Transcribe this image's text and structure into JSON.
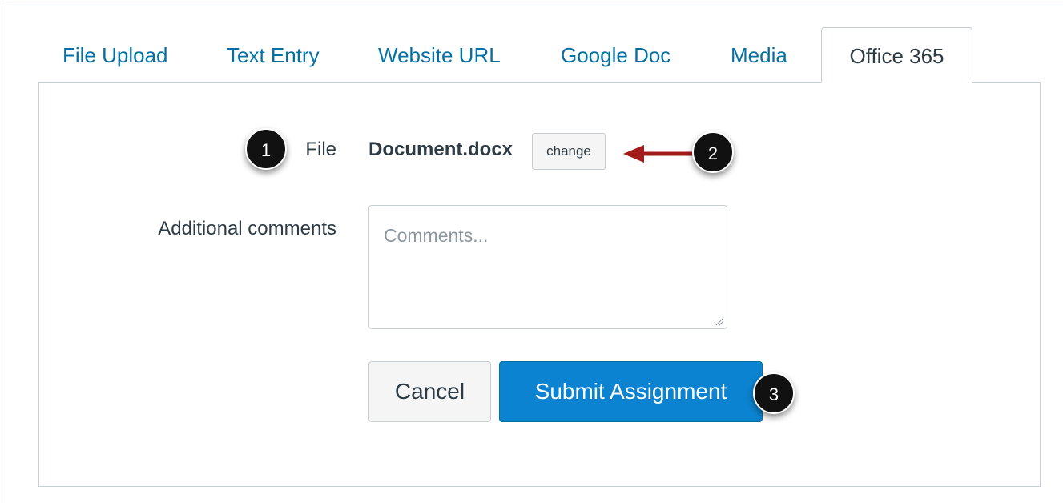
{
  "tabs": [
    {
      "label": "File Upload"
    },
    {
      "label": "Text Entry"
    },
    {
      "label": "Website URL"
    },
    {
      "label": "Google Doc"
    },
    {
      "label": "Media"
    },
    {
      "label": "Office 365"
    }
  ],
  "active_tab": "Office 365",
  "form": {
    "file_label": "File",
    "file_name": "Document.docx",
    "change_label": "change",
    "comments_label": "Additional comments",
    "comments_placeholder": "Comments...",
    "comments_value": "",
    "cancel_label": "Cancel",
    "submit_label": "Submit Assignment"
  },
  "callouts": {
    "one": "1",
    "two": "2",
    "three": "3"
  },
  "colors": {
    "link": "#0770a3",
    "primary": "#0b83d0",
    "text": "#2d3b45",
    "border": "#c7cdd1",
    "arrow": "#a31c1c",
    "callout": "#111111"
  }
}
